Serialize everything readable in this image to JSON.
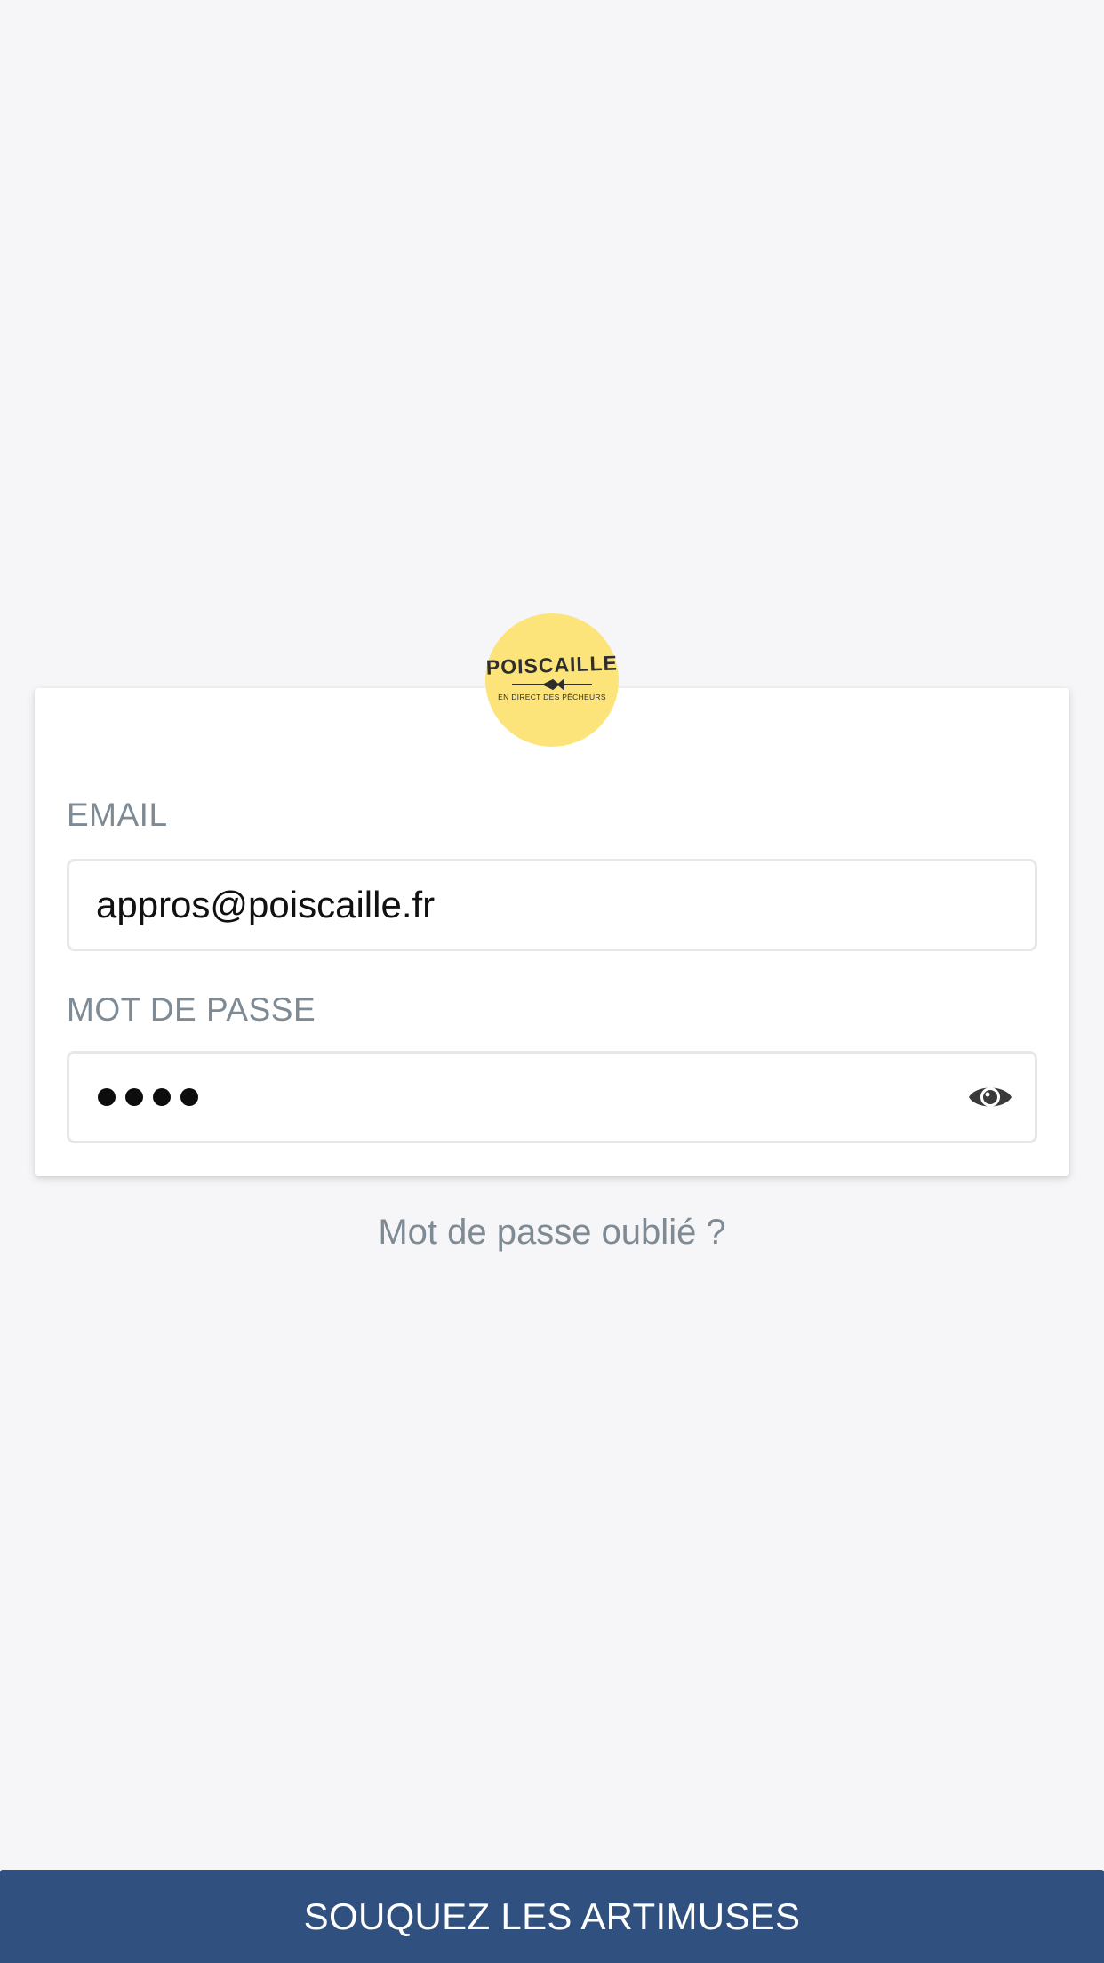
{
  "logo": {
    "brand_name": "POISCAILLE",
    "tagline": "EN DIRECT DES PÊCHEURS",
    "color": "#fde47a"
  },
  "login_form": {
    "email_label": "EMAIL",
    "email_value": "appros@poiscaille.fr",
    "password_label": "MOT DE PASSE",
    "password_masked_length": 4,
    "show_password_icon": "eye-icon"
  },
  "forgot_password_link": "Mot de passe oublié ?",
  "submit_button": {
    "label": "SOUQUEZ LES ARTIMUSES",
    "color": "#30507f"
  },
  "colors": {
    "background": "#f6f6f8",
    "label_text": "#7f8b94",
    "input_border": "#e6e7e8"
  }
}
